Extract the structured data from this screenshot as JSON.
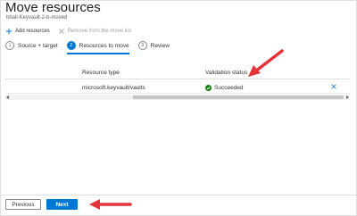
{
  "blade": {
    "title": "Move resources",
    "ellipsis": "···",
    "subtitle": "bball-Keyvault-2-b-moved"
  },
  "toolbar": {
    "add_label": "Add resources",
    "remove_label": "Remove from the move list"
  },
  "steps": [
    {
      "number": "1",
      "label": "Source + target",
      "active": false
    },
    {
      "number": "2",
      "label": "Resources to move",
      "active": true
    },
    {
      "number": "3",
      "label": "Review",
      "active": false
    }
  ],
  "grid": {
    "columns": [
      "Resource type",
      "Validation status"
    ],
    "rows": [
      {
        "resource_type": "microsoft.keyvault/vaults",
        "status": "Succeeded"
      }
    ]
  },
  "footer": {
    "previous_label": "Previous",
    "next_label": "Next"
  },
  "colors": {
    "accent": "#0078d4",
    "success": "#107c10",
    "annotation_arrow": "#e3343a"
  },
  "icons": {
    "add": "plus-icon",
    "remove": "close-icon",
    "status": "checkmark-circle-icon",
    "row_remove": "close-icon"
  }
}
